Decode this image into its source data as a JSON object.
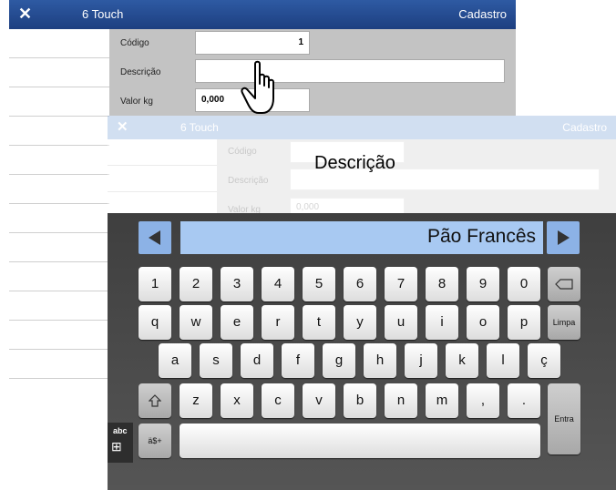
{
  "window": {
    "title": "6 Touch",
    "section": "Cadastro"
  },
  "form": {
    "codigo_label": "Código",
    "codigo_value": "1",
    "descricao_label": "Descrição",
    "descricao_value": "",
    "valorkg_label": "Valor kg",
    "valorkg_value": "0,000"
  },
  "faded": {
    "title": "6 Touch",
    "section": "Cadastro",
    "codigo_label": "Código",
    "descricao_label": "Descrição",
    "valorkg_label": "Valor kg",
    "valorkg_value": "0,000"
  },
  "overlay_caption": "Descrição",
  "keyboard": {
    "input_value": "Pão Francês",
    "row1": [
      "1",
      "2",
      "3",
      "4",
      "5",
      "6",
      "7",
      "8",
      "9",
      "0"
    ],
    "row2": [
      "q",
      "w",
      "e",
      "r",
      "t",
      "y",
      "u",
      "i",
      "o",
      "p"
    ],
    "row3": [
      "a",
      "s",
      "d",
      "f",
      "g",
      "h",
      "j",
      "k",
      "l",
      "ç"
    ],
    "row4": [
      "z",
      "x",
      "c",
      "v",
      "b",
      "n",
      "m",
      ",",
      "."
    ],
    "backspace_icon": "backspace-icon",
    "shift_icon": "shift-icon",
    "limpa": "Limpa",
    "entra": "Entra",
    "symbols": "ä$+",
    "mode_label": "abc",
    "mode_icon": "⊞"
  },
  "colors": {
    "titlebar": "#1d3f80",
    "display": "#a8c9f2",
    "nav": "#8cb2e6"
  }
}
